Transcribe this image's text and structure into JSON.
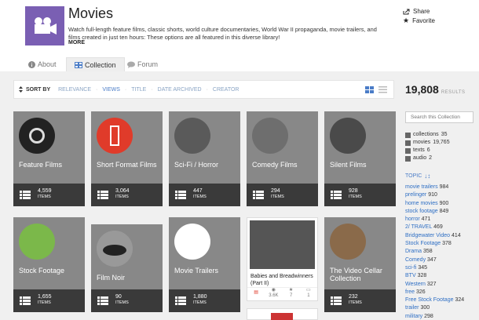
{
  "header": {
    "title": "Movies",
    "description": "Watch full-length feature films, classic shorts, world culture documentaries, World War II propaganda, movie trailers, and films created in just ten hours: These options are all featured in this diverse library!",
    "more": "MORE",
    "share": "Share",
    "favorite": "Favorite",
    "logo_color": "#7a5fb3"
  },
  "tabs": {
    "about": "About",
    "collection": "Collection",
    "forum": "Forum"
  },
  "sort": {
    "label": "SORT BY",
    "options": [
      "RELEVANCE",
      "VIEWS",
      "TITLE",
      "DATE ARCHIVED",
      "CREATOR"
    ],
    "active": "VIEWS"
  },
  "results": {
    "count": "19,808",
    "label": "RESULTS"
  },
  "search": {
    "placeholder": "Search this Collection"
  },
  "facets": [
    {
      "label": "collections",
      "count": "35"
    },
    {
      "label": "movies",
      "count": "19,765"
    },
    {
      "label": "texts",
      "count": "6"
    },
    {
      "label": "audio",
      "count": "2"
    }
  ],
  "topic_label": "TOPIC",
  "topics": [
    {
      "label": "movie trailers",
      "count": "984"
    },
    {
      "label": "prelinger",
      "count": "910"
    },
    {
      "label": "home movies",
      "count": "900"
    },
    {
      "label": "stock footage",
      "count": "849"
    },
    {
      "label": "horror",
      "count": "471"
    },
    {
      "label": "2/ TRAVEL",
      "count": "469"
    },
    {
      "label": "Bridgewater Video",
      "count": "414"
    },
    {
      "label": "Stock Footage",
      "count": "378"
    },
    {
      "label": "Drama",
      "count": "358"
    },
    {
      "label": "Comedy",
      "count": "347"
    },
    {
      "label": "sci-fi",
      "count": "345"
    },
    {
      "label": "BTV",
      "count": "328"
    },
    {
      "label": "Western",
      "count": "327"
    },
    {
      "label": "free",
      "count": "326"
    },
    {
      "label": "Free Stock Footage",
      "count": "324"
    },
    {
      "label": "trailer",
      "count": "300"
    },
    {
      "label": "military",
      "count": "298"
    }
  ],
  "items_label": "ITEMS",
  "cards": [
    {
      "title": "Feature Films",
      "count": "4,559"
    },
    {
      "title": "Short Format Films",
      "count": "3,064"
    },
    {
      "title": "Sci-Fi / Horror",
      "count": "447"
    },
    {
      "title": "Comedy Films",
      "count": "294"
    },
    {
      "title": "Silent Films",
      "count": "928"
    },
    {
      "title": "Stock Footage",
      "count": "1,655"
    },
    {
      "title": "Film Noir",
      "count": "90"
    },
    {
      "title": "Movie Trailers",
      "count": "1,880"
    },
    {
      "title": "The Video Cellar Collection",
      "count": "232"
    }
  ],
  "item_card": {
    "title": "Babies and Breadwinners (Part II)",
    "views": "3.6K",
    "favs": "7",
    "reviews": "1"
  }
}
